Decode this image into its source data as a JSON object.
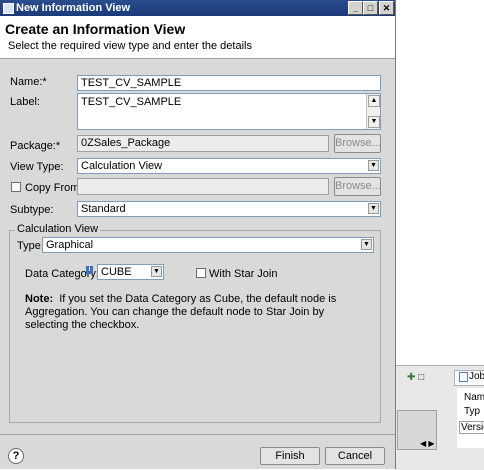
{
  "window": {
    "title": "New Information View",
    "min_label": "_",
    "max_label": "□",
    "close_label": "✕"
  },
  "header": {
    "title": "Create an Information View",
    "subtitle": "Select the required view type and enter the details"
  },
  "form": {
    "name_label": "Name:*",
    "name_value": "TEST_CV_SAMPLE",
    "label_label": "Label:",
    "label_value": "TEST_CV_SAMPLE",
    "package_label": "Package:*",
    "package_value": "0ZSales_Package",
    "browse_label": "Browse...",
    "viewtype_label": "View Type:",
    "viewtype_value": "Calculation View",
    "copyfrom_label": "Copy From:",
    "copyfrom_value": "",
    "browse2_label": "Browse...",
    "subtype_label": "Subtype:",
    "subtype_value": "Standard"
  },
  "calc_group": {
    "title": "Calculation View",
    "type_label": "Type:",
    "type_value": "Graphical",
    "datacat_label": "Data Category:",
    "datacat_value": "CUBE",
    "star_join_label": "With Star Join",
    "note_label": "Note:",
    "note_text": "If you set the Data Category as Cube, the default node is Aggregation. You can change the default node to Star Join by selecting the checkbox."
  },
  "buttons": {
    "finish": "Finish",
    "cancel": "Cancel",
    "help": "?"
  },
  "background": {
    "job_tab": "Job",
    "row1": "Nam",
    "row2": "Typ",
    "row3": "Versio"
  }
}
